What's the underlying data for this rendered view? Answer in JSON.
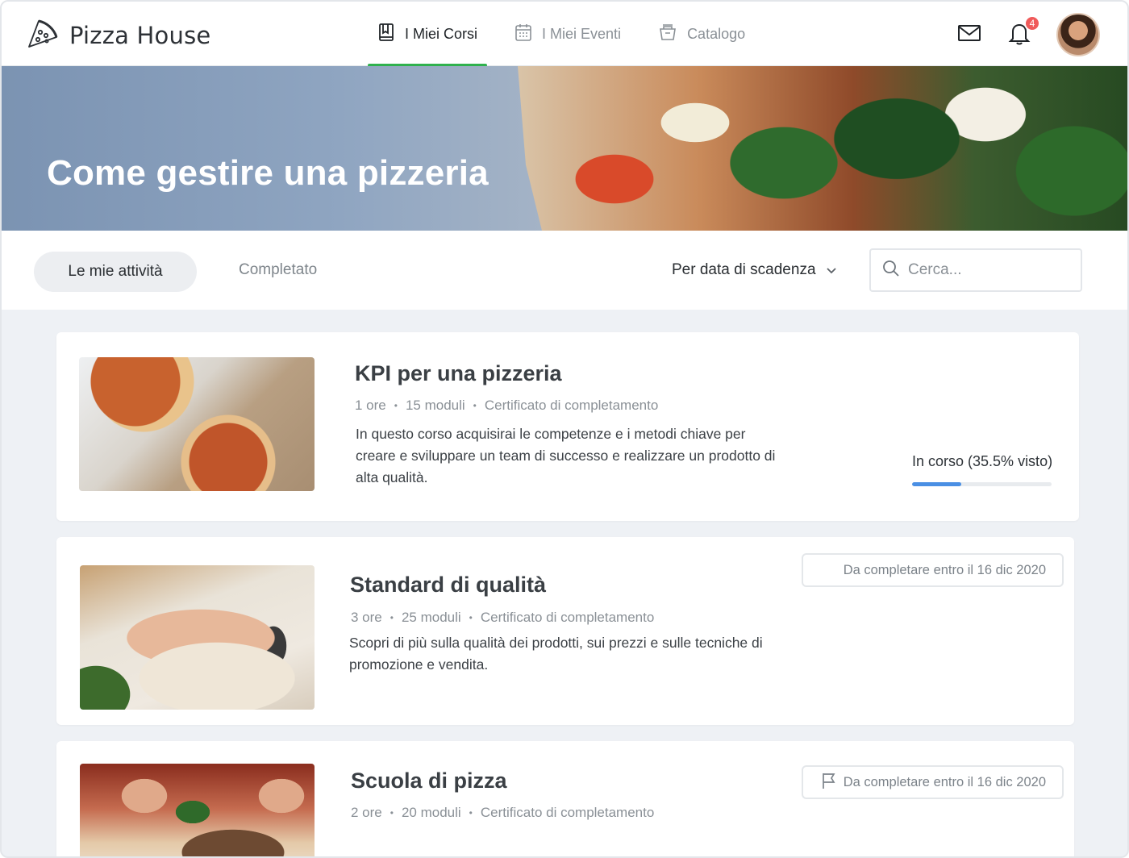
{
  "brand": {
    "name": "Pizza House",
    "icon": "pizza-slice-icon"
  },
  "nav": [
    {
      "label": "I Miei Corsi",
      "icon": "book-icon",
      "active": true
    },
    {
      "label": "I Miei Eventi",
      "icon": "calendar-icon",
      "active": false
    },
    {
      "label": "Catalogo",
      "icon": "basket-icon",
      "active": false
    }
  ],
  "header_actions": {
    "notifications_count": "4"
  },
  "hero": {
    "title": "Come gestire una pizzeria"
  },
  "filters": {
    "tabs": [
      "Le mie attività",
      "Completato"
    ],
    "active_tab": "Le mie attività",
    "sort_label": "Per data di scadenza",
    "search_placeholder": "Cerca..."
  },
  "courses": [
    {
      "title": "KPI per una pizzeria",
      "duration": "1 ore",
      "modules": "15 moduli",
      "certificate": "Certificato di completamento",
      "description": "In questo corso acquisirai le competenze e i metodi chiave per creare e sviluppare un team di successo e realizzare un prodotto di alta qualità.",
      "status": "In corso (35.5% visto)",
      "progress": 0.355
    },
    {
      "title": "Standard di qualità",
      "duration": "3 ore",
      "modules": "25 moduli",
      "certificate": "Certificato di completamento",
      "description": "Scopri di più sulla qualità dei prodotti, sui prezzi e sulle tecniche di promozione e vendita.",
      "due": "Da completare entro il 16 dic 2020"
    },
    {
      "title": "Scuola di pizza",
      "duration": "2 ore",
      "modules": "20 moduli",
      "certificate": "Certificato di completamento",
      "due": "Da completare entro il 16 dic 2020"
    }
  ],
  "colors": {
    "accent_green": "#2fb14d",
    "progress_blue": "#4a8fe4",
    "badge_red": "#f05a5a"
  }
}
